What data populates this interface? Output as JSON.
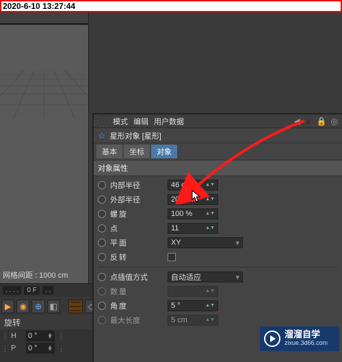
{
  "timestamp": "2020-6-10 13:27:44",
  "viewport": {
    "grid_status": "网格间距 : 1000 cm"
  },
  "hud": {
    "dots": ". . . .",
    "temp": "0 F",
    "dots2": ". ."
  },
  "rotate_label": "旋转",
  "bottom": {
    "h_label": "H",
    "h_value": "0 °",
    "p_label": "P",
    "p_value": "0 °"
  },
  "header_menus": [
    "模式",
    "编辑",
    "用户数据"
  ],
  "object": {
    "name": "星形对象 [星形]"
  },
  "tabs": {
    "basic": "基本",
    "coord": "坐标",
    "object": "对象"
  },
  "section": "对象属性",
  "props": {
    "inner_radius": {
      "label": "内部半径",
      "value": "46 cm"
    },
    "outer_radius": {
      "label": "外部半径",
      "value": "200 cm"
    },
    "twist": {
      "label": "螺旋",
      "value": "100 %"
    },
    "points": {
      "label": "点",
      "value": "11"
    },
    "plane": {
      "label": "平面",
      "value": "XY"
    },
    "reverse": {
      "label": "反转"
    },
    "interp_mode": {
      "label": "点插值方式",
      "value": "自动适应"
    },
    "count": {
      "label": "数量",
      "value": ""
    },
    "angle": {
      "label": "角度",
      "value": "5 °"
    },
    "max_length": {
      "label": "最大长度",
      "value": "5 cm"
    }
  },
  "watermark": {
    "title": "溜溜自学",
    "subtitle": "zixue.3d66.com"
  }
}
